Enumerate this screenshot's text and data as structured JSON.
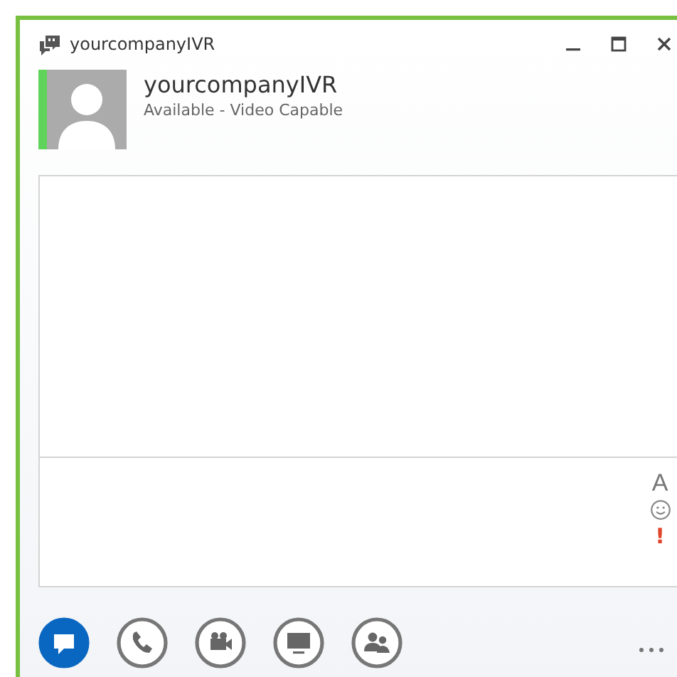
{
  "window": {
    "title": "yourcompanyIVR"
  },
  "contact": {
    "name": "yourcompanyIVR",
    "status": "Available - Video Capable",
    "available": true
  },
  "compose": {
    "font_button": "A",
    "important_button": "!"
  },
  "actions": [
    {
      "kind": "im",
      "selected": true
    },
    {
      "kind": "call",
      "selected": false
    },
    {
      "kind": "video",
      "selected": false
    },
    {
      "kind": "screen",
      "selected": false
    },
    {
      "kind": "people",
      "selected": false
    }
  ]
}
